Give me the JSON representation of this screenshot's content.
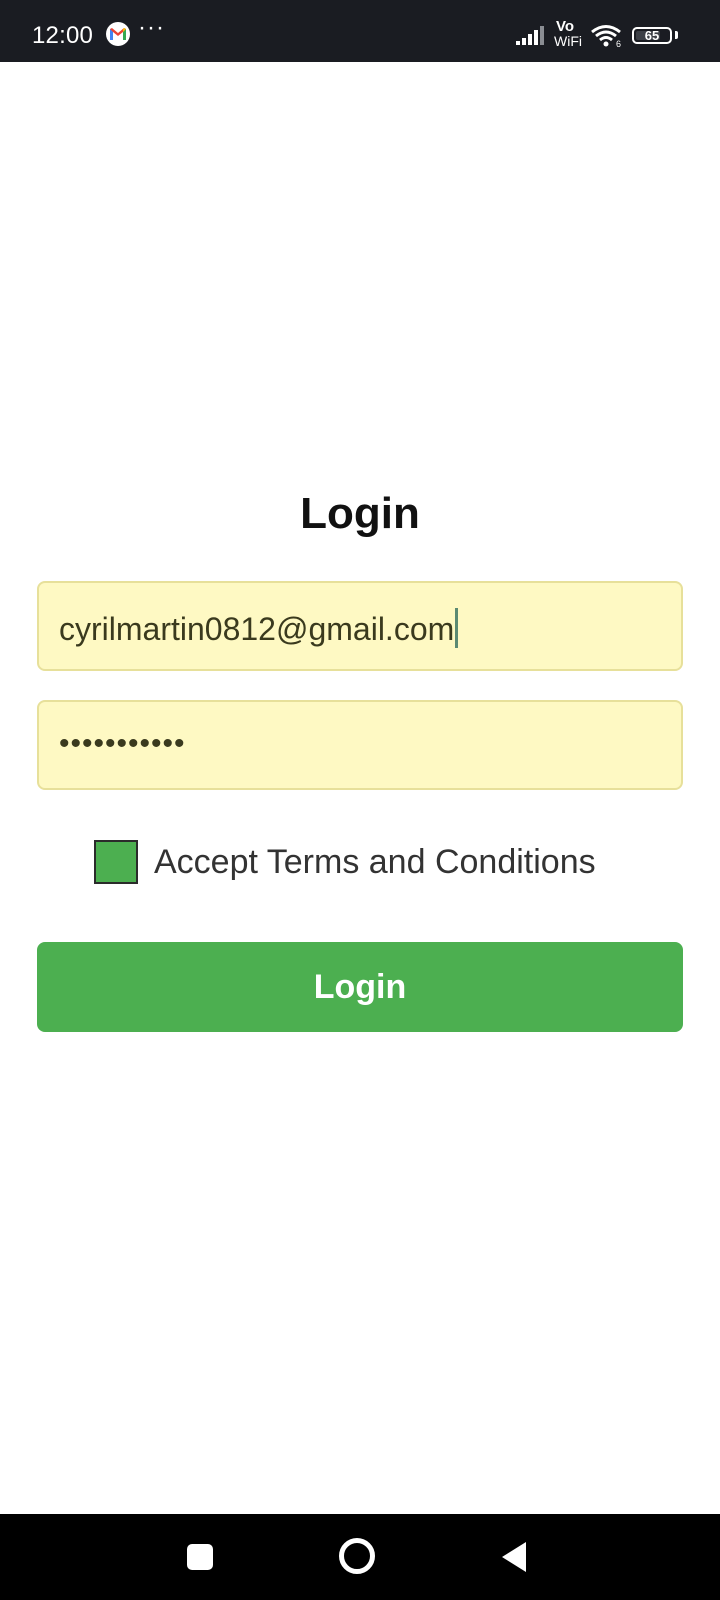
{
  "status_bar": {
    "time": "12:00",
    "notification_app_icon": "gmail-icon",
    "more_indicator": "···",
    "signal_icon": "cellular-signal-icon",
    "vowifi_top": "Vo",
    "vowifi_bottom": "WiFi",
    "wifi_icon": "wifi-icon",
    "battery_level": "65"
  },
  "login": {
    "title": "Login",
    "email_value": "cyrilmartin0812@gmail.com",
    "password_masked": "•••••••••••",
    "terms_label": "Accept Terms and Conditions",
    "terms_checked": true,
    "button_label": "Login"
  },
  "colors": {
    "accent": "#4caf50",
    "input_background": "#fef9c3",
    "status_bar_background": "#1a1c22"
  },
  "nav_bar": {
    "recents_icon": "recents-square-icon",
    "home_icon": "home-circle-icon",
    "back_icon": "back-triangle-icon"
  }
}
